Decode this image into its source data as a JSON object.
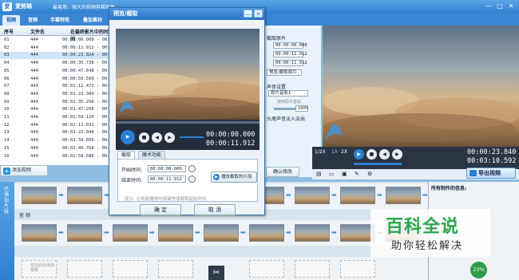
{
  "app": {
    "title": "爱剪辑",
    "slogan": "最易用、强大的视频剪辑软件",
    "logo_glyph": "爱"
  },
  "window_controls": [
    "—",
    "□",
    "✕"
  ],
  "tabs": [
    "视频",
    "音频",
    "字幕特效",
    "叠加素材"
  ],
  "video_list": {
    "headers": [
      "序号",
      "文件名",
      "在最终影片中的时间"
    ],
    "rows": [
      {
        "no": "01",
        "name": "444",
        "time": "00:00:00.000 - 00:00:"
      },
      {
        "no": "02",
        "name": "444",
        "time": "00:00:11.912 - 00:00:"
      },
      {
        "no": "03",
        "name": "444",
        "time": "00:00:23.824 - 00:00:"
      },
      {
        "no": "04",
        "name": "444",
        "time": "00:00:35.736 - 00:00:"
      },
      {
        "no": "05",
        "name": "444",
        "time": "00:00:47.648 - 00:00:"
      },
      {
        "no": "06",
        "name": "444",
        "time": "00:00:59.560 - 00:01:"
      },
      {
        "no": "07",
        "name": "444",
        "time": "00:01:11.472 - 00:01:"
      },
      {
        "no": "08",
        "name": "444",
        "time": "00:01:23.384 - 00:01:"
      },
      {
        "no": "09",
        "name": "444",
        "time": "00:01:35.296 - 00:01:"
      },
      {
        "no": "10",
        "name": "444",
        "time": "00:01:47.208 - 00:01:"
      },
      {
        "no": "11",
        "name": "444",
        "time": "00:01:59.120 - 00:02:"
      },
      {
        "no": "12",
        "name": "444",
        "time": "00:02:11.032 - 00:02:"
      },
      {
        "no": "13",
        "name": "444",
        "time": "00:02:22.944 - 00:02:"
      },
      {
        "no": "14",
        "name": "444",
        "time": "00:02:34.856 - 00:02:"
      },
      {
        "no": "15",
        "name": "444",
        "time": "00:02:46.768 - 00:02:"
      },
      {
        "no": "16",
        "name": "444",
        "time": "00:02:58.680 - 00:03:"
      }
    ],
    "selected_index": 2
  },
  "add_video_label": "添加视频",
  "settings": {
    "section1": "截取原片",
    "times": [
      "00:00:00.000",
      "00:00:11.912",
      "00:00:11.912"
    ],
    "snapshot_label": "预览/截取原片",
    "audio_section": "声音设置",
    "audio_option": "原片音轨1",
    "audio_note": "使用原片音轨",
    "volume": "100%",
    "fade_label": "头尾声音淡入淡出",
    "confirm_label": "确认修改"
  },
  "preview": {
    "speeds": [
      "1/2X",
      "1X",
      "2X"
    ],
    "time_current": "00:00:23.840",
    "time_total": "00:03:10.592",
    "export_label": "导出视频"
  },
  "dialog": {
    "title": "预览/截取",
    "time_current": "00:00:00.000",
    "time_total": "00:00:11.912",
    "tabs": [
      "截取",
      "魔术功能"
    ],
    "start_label": "开始时间:",
    "start_value": "00:00:00.000",
    "end_label": "结束时间:",
    "end_value": "00:00:11.912",
    "play_selection_label": "播放截取的片段",
    "hint": "提示: 在视频播放时按键快速截取起始时间",
    "ok_label": "确 定",
    "cancel_label": "取 消"
  },
  "timeline": {
    "side_label": "已添加片段",
    "audio_label": "音 频",
    "info_title": "所有制作的信息:",
    "usage_percent": "23%",
    "add_label": "双击此处添加视频"
  },
  "watermark": {
    "big": "百科全说",
    "small": "助你轻松解决"
  },
  "colors": {
    "title_bar": "#2f7fd0",
    "selection": "#cfe4fa",
    "accent": "#2c7fd6",
    "watermark_green": "#29a64a"
  }
}
